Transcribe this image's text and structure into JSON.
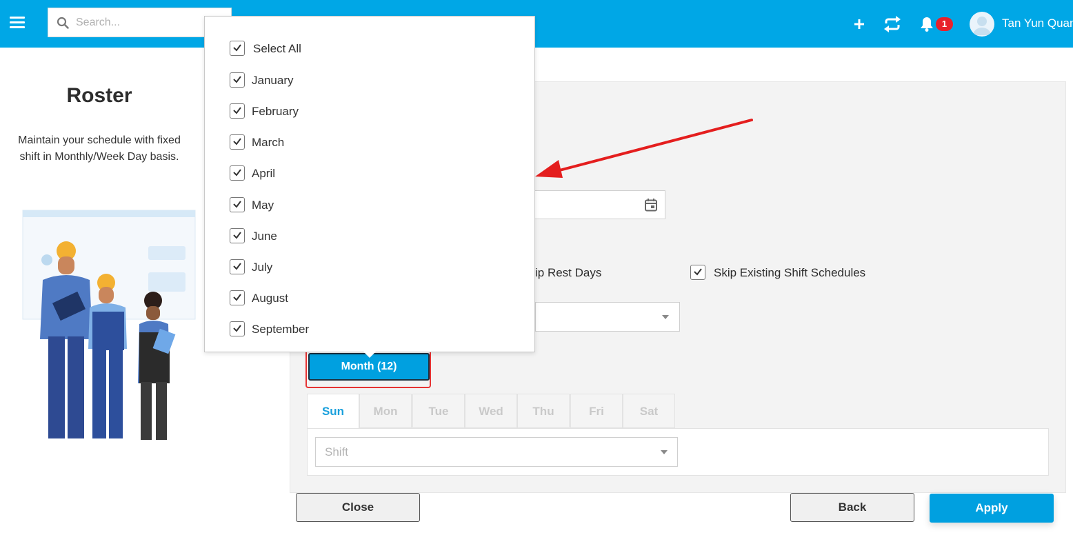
{
  "header": {
    "search_placeholder": "Search...",
    "notification_count": "1",
    "user_name": "Tan Yun Quan",
    "icons": [
      "menu-icon",
      "search-icon",
      "plus-icon",
      "sync-icon",
      "bell-icon",
      "user-avatar"
    ],
    "accent": "#00a7e6"
  },
  "intro": {
    "title": "Roster",
    "description": "Maintain your schedule with fixed shift in Monthly/Week Day basis."
  },
  "form": {
    "skip_rest_days_label": "ip Rest Days",
    "skip_existing_label": "Skip Existing Shift Schedules",
    "skip_existing_checked": true,
    "month_button_label": "Month (12)",
    "days": [
      "Sun",
      "Mon",
      "Tue",
      "Wed",
      "Thu",
      "Fri",
      "Sat"
    ],
    "active_day": "Sun",
    "shift_placeholder": "Shift"
  },
  "month_dropdown": {
    "items": [
      {
        "label": "Select All",
        "checked": true
      },
      {
        "label": "January",
        "checked": true
      },
      {
        "label": "February",
        "checked": true
      },
      {
        "label": "March",
        "checked": true
      },
      {
        "label": "April",
        "checked": true
      },
      {
        "label": "May",
        "checked": true
      },
      {
        "label": "June",
        "checked": true
      },
      {
        "label": "July",
        "checked": true
      },
      {
        "label": "August",
        "checked": true
      },
      {
        "label": "September",
        "checked": true
      }
    ]
  },
  "actions": {
    "close_label": "Close",
    "back_label": "Back",
    "apply_label": "Apply"
  },
  "colors": {
    "primary": "#00a0e0",
    "highlight_outline": "#e63333",
    "badge": "#e8212b"
  }
}
